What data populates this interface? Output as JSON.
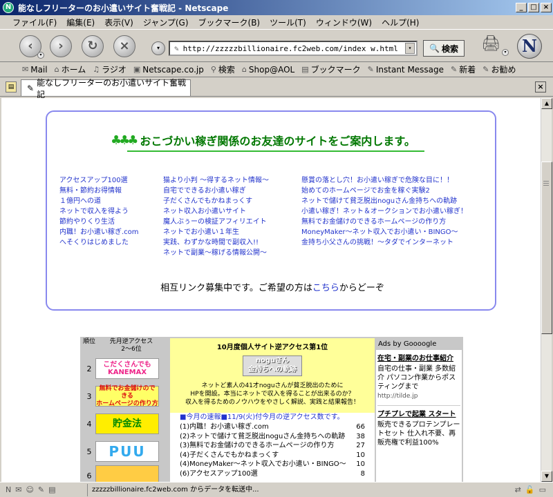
{
  "window": {
    "title": "能なしフリーターのお小遣いサイト奮戦記 - Netscape",
    "min": "_",
    "max": "□",
    "close": "×"
  },
  "menu": [
    "ファイル(F)",
    "編集(E)",
    "表示(V)",
    "ジャンプ(G)",
    "ブックマーク(B)",
    "ツール(T)",
    "ウィンドウ(W)",
    "ヘルプ(H)"
  ],
  "nav": {
    "url": "http://zzzzzbillionaire.fc2web.com/index w.html",
    "search_label": "検索",
    "logo": "N"
  },
  "personal_bar": [
    "Mail",
    "ホーム",
    "ラジオ",
    "Netscape.co.jp",
    "検索",
    "Shop@AOL",
    "ブックマーク",
    "Instant Message",
    "新着",
    "お勧め"
  ],
  "tab": {
    "title": "能なしフリーターのお小遣いサイト奮戦記"
  },
  "friends": {
    "title": "おこづかい稼ぎ関係のお友達のサイトをご案内します。",
    "col1": [
      "アクセスアップ100選",
      "無料・節約お得情報",
      "１億円への道",
      "ネットで収入を得よう",
      "節約やりくり生活",
      "内職！お小遣い稼ぎ.com",
      "へそくりはじめました"
    ],
    "col2": [
      "猫より小判 ～得するネット情報～",
      "自宅でできるお小遣い稼ぎ",
      "子だくさんでもかねまっくす",
      "ネット収入お小遣いサイト",
      "魔人ぶぅーの検証アフィリエイト",
      "ネットでお小遣い１年生",
      "実践、わずかな時間で副収入!!",
      "ネットで副業～稼げる情報公開～"
    ],
    "col3": [
      "懸賞の落とし穴！お小遣い稼ぎで危険な目に！！",
      "始めてのホームページでお金を稼ぐ実験2",
      "ネットで儲けて貧乏脱出noguさん金持ちへの軌跡",
      "小遣い稼ぎ！ネット＆オークションでお小遣い稼ぎ！",
      "無料でお金儲けのできるホームページの作り方",
      "MoneyMaker～ネット収入でお小遣い・BINGO～",
      "金持ち小父さんの挑戦！～タダでインターネット"
    ],
    "mutual_pre": "相互リンク募集中です。ご希望の方は",
    "mutual_link": "こちら",
    "mutual_post": "からどーぞ"
  },
  "ranking": {
    "head_rank": "順位",
    "head_access": "先月逆アクセス\n2～6位",
    "rows": [
      {
        "rank": "2",
        "banner": "こだくさんでも\nKANEMAX"
      },
      {
        "rank": "3",
        "banner": "無料でお金儲けのできる\nホームページの作り方"
      },
      {
        "rank": "4",
        "banner": "貯金法"
      },
      {
        "rank": "5",
        "banner": "PUU"
      },
      {
        "rank": "6",
        "banner": ""
      }
    ],
    "featured_title": "10月度個人サイト逆アクセス第1位",
    "featured_banner": "noguさん\n金持ちへの軌跡",
    "featured_text": "ネットど素人の41才noguさんが貧乏脱出のために\nHPを開設。本当にネットで収入を得ることが出来るのか？\n収入を得るためのノウハウをやさしく解説、実践と結果報告！",
    "list_head": "■今月の速報■11/9(火)付今月の逆アクセス数です。",
    "list": [
      {
        "t": "(1)内職！お小遣い稼ぎ.com",
        "c": "66"
      },
      {
        "t": "(2)ネットで儲けて貧乏脱出noguさん金持ちへの軌跡",
        "c": "38"
      },
      {
        "t": "(3)無料でお金儲けのできるホームページの作り方",
        "c": "27"
      },
      {
        "t": "(4)子だくさんでもかねまっくす",
        "c": "10"
      },
      {
        "t": "(4)MoneyMaker～ネット収入でお小遣い・BINGO～",
        "c": "10"
      },
      {
        "t": "(6)アクセスアップ100選",
        "c": "8"
      }
    ]
  },
  "ads": {
    "head": "Ads by Goooogle",
    "ad1_title": "在宅・副業のお仕事紹介",
    "ad1_text": "自宅の仕事・副業 多数紹介 パソコン作業からポスティングまで",
    "ad1_url": "http://tilde.jp",
    "ad2_title": "プチプレで起業 スタート",
    "ad2_text": "販売できるプロテンプレートセット 仕入れ不要、再販売権で利益100%"
  },
  "status": {
    "text": "zzzzzbillionaire.fc2web.com からデータを転送中..."
  }
}
